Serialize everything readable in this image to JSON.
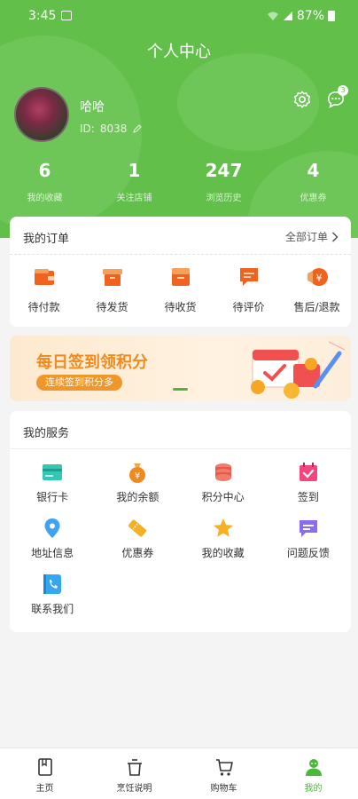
{
  "status_bar": {
    "time": "3:45",
    "battery": "87%"
  },
  "header": {
    "title": "个人中心"
  },
  "profile": {
    "name": "哈哈",
    "id_label": "ID:",
    "id_value": "8038",
    "message_badge": "3"
  },
  "stats": [
    {
      "value": "6",
      "label": "我的收藏"
    },
    {
      "value": "1",
      "label": "关注店铺"
    },
    {
      "value": "247",
      "label": "浏览历史"
    },
    {
      "value": "4",
      "label": "优惠券"
    }
  ],
  "orders": {
    "title": "我的订单",
    "all_label": "全部订单",
    "items": [
      {
        "label": "待付款",
        "icon": "wallet-icon"
      },
      {
        "label": "待发货",
        "icon": "box-icon"
      },
      {
        "label": "待收货",
        "icon": "package-icon"
      },
      {
        "label": "待评价",
        "icon": "comment-icon"
      },
      {
        "label": "售后/退款",
        "icon": "refund-icon"
      }
    ]
  },
  "banner": {
    "title": "每日签到领积分",
    "subtitle": "连续签到积分多"
  },
  "services": {
    "title": "我的服务",
    "items": [
      {
        "label": "银行卡",
        "icon": "bank-card-icon"
      },
      {
        "label": "我的余额",
        "icon": "money-bag-icon"
      },
      {
        "label": "积分中心",
        "icon": "points-icon"
      },
      {
        "label": "签到",
        "icon": "calendar-check-icon"
      },
      {
        "label": "地址信息",
        "icon": "location-icon"
      },
      {
        "label": "优惠券",
        "icon": "coupon-icon"
      },
      {
        "label": "我的收藏",
        "icon": "star-icon"
      },
      {
        "label": "问题反馈",
        "icon": "feedback-icon"
      },
      {
        "label": "联系我们",
        "icon": "phone-icon"
      }
    ]
  },
  "tabbar": [
    {
      "label": "主页",
      "icon": "book-icon"
    },
    {
      "label": "烹饪说明",
      "icon": "cooking-icon"
    },
    {
      "label": "购物车",
      "icon": "cart-icon"
    },
    {
      "label": "我的",
      "icon": "user-icon",
      "active": true
    }
  ],
  "colors": {
    "brand": "#62c04a",
    "accent_orange": "#f0621e",
    "tab_active": "#4cb83a"
  }
}
